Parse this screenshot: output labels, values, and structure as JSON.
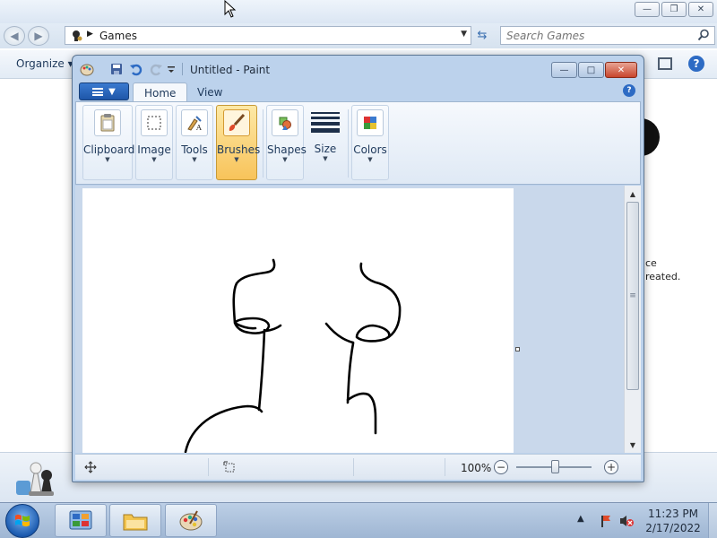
{
  "explorer": {
    "address_text": "Games",
    "search_placeholder": "Search Games",
    "organize_label": "Organize",
    "details_line1": "ce",
    "details_line2": "reated."
  },
  "paint": {
    "title": "Untitled - Paint",
    "tabs": [
      {
        "label": "Home",
        "active": true
      },
      {
        "label": "View",
        "active": false
      }
    ],
    "groups": [
      {
        "label": "Clipboard",
        "icon": "clipboard-icon"
      },
      {
        "label": "Image",
        "icon": "select-icon"
      },
      {
        "label": "Tools",
        "icon": "tools-icon"
      },
      {
        "label": "Brushes",
        "icon": "brush-icon",
        "active": true
      },
      {
        "label": "Shapes",
        "icon": "shapes-icon"
      },
      {
        "label": "Size",
        "icon": "size-icon"
      },
      {
        "label": "Colors",
        "icon": "colors-icon"
      }
    ],
    "zoom_label": "100%",
    "zoom_level_percent": 100
  },
  "taskbar": {
    "time": "11:23 PM",
    "date": "2/17/2022"
  },
  "colors": {
    "accent": "#2d6bc4",
    "active_group": "#f8c35a",
    "close_button": "#c8452c"
  }
}
